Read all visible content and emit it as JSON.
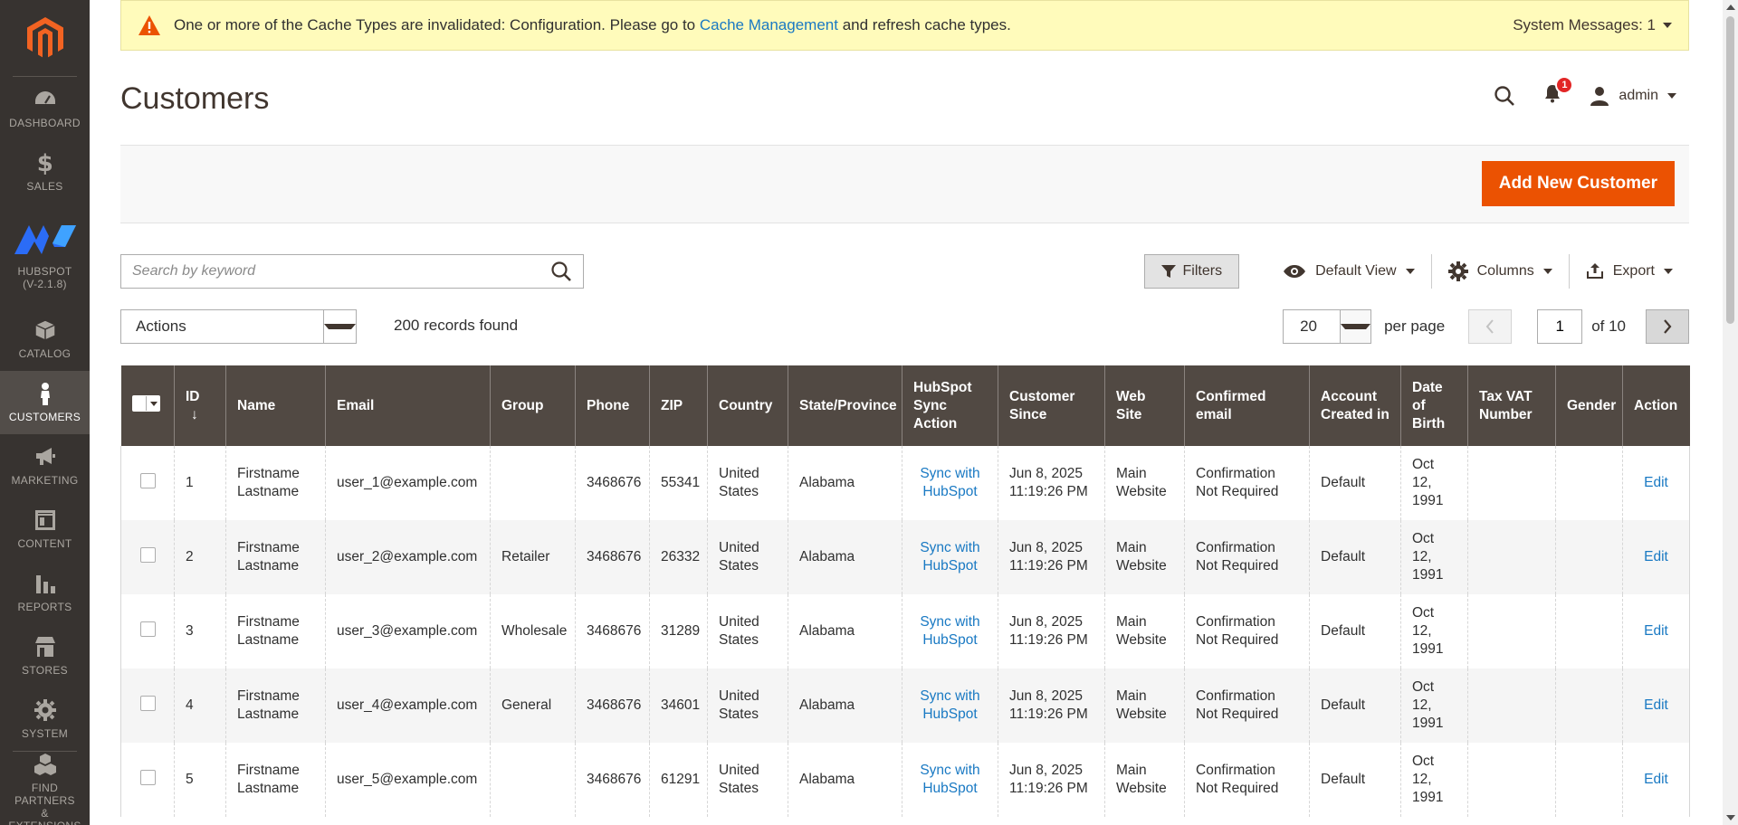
{
  "sidebar": {
    "items": [
      {
        "label": "DASHBOARD",
        "icon": "dashboard-icon"
      },
      {
        "label": "SALES",
        "icon": "dollar-icon"
      },
      {
        "label": "HUBSPOT",
        "sub": "(V-2.1.8)",
        "icon": "hubspot-logo-icon"
      },
      {
        "label": "CATALOG",
        "icon": "box-icon"
      },
      {
        "label": "CUSTOMERS",
        "icon": "person-icon"
      },
      {
        "label": "MARKETING",
        "icon": "megaphone-icon"
      },
      {
        "label": "CONTENT",
        "icon": "layout-icon"
      },
      {
        "label": "REPORTS",
        "icon": "bar-chart-icon"
      },
      {
        "label": "STORES",
        "icon": "store-icon"
      },
      {
        "label": "SYSTEM",
        "icon": "gear-icon"
      },
      {
        "label": "FIND PARTNERS",
        "sub": "& EXTENSIONS",
        "icon": "cubes-icon"
      }
    ]
  },
  "sysmsg": {
    "text_before": "One or more of the Cache Types are invalidated: Configuration. Please go to",
    "link": "Cache Management",
    "text_after": "and refresh cache types.",
    "right": "System Messages: 1"
  },
  "header": {
    "title": "Customers",
    "notifications": "1",
    "user": "admin"
  },
  "toolbar": {
    "add_label": "Add New Customer"
  },
  "search": {
    "placeholder": "Search by keyword"
  },
  "tools": {
    "filters": "Filters",
    "view": "Default View",
    "columns": "Columns",
    "export": "Export"
  },
  "actions": {
    "label": "Actions",
    "records": "200 records found"
  },
  "pager": {
    "per_page_value": "20",
    "per_page_label": "per page",
    "current": "1",
    "of": "of 10"
  },
  "columns": [
    "ID",
    "Name",
    "Email",
    "Group",
    "Phone",
    "ZIP",
    "Country",
    "State/Province",
    "HubSpot Sync Action",
    "Customer Since",
    "Web Site",
    "Confirmed email",
    "Account Created in",
    "Date of Birth",
    "Tax VAT Number",
    "Gender",
    "Action"
  ],
  "sort_indicator": "↓",
  "rows": [
    {
      "id": "1",
      "name": "Firstname Lastname",
      "email": "user_1@example.com",
      "group": "",
      "phone": "3468676",
      "zip": "55341",
      "country": "United States",
      "state": "Alabama",
      "sync": "Sync with HubSpot",
      "since": "Jun 8, 2025 11:19:26 PM",
      "website": "Main Website",
      "confirmed": "Confirmation Not Required",
      "created_in": "Default",
      "dob": "Oct 12, 1991",
      "taxvat": "",
      "gender": "",
      "action": "Edit"
    },
    {
      "id": "2",
      "name": "Firstname Lastname",
      "email": "user_2@example.com",
      "group": "Retailer",
      "phone": "3468676",
      "zip": "26332",
      "country": "United States",
      "state": "Alabama",
      "sync": "Sync with HubSpot",
      "since": "Jun 8, 2025 11:19:26 PM",
      "website": "Main Website",
      "confirmed": "Confirmation Not Required",
      "created_in": "Default",
      "dob": "Oct 12, 1991",
      "taxvat": "",
      "gender": "",
      "action": "Edit"
    },
    {
      "id": "3",
      "name": "Firstname Lastname",
      "email": "user_3@example.com",
      "group": "Wholesale",
      "phone": "3468676",
      "zip": "31289",
      "country": "United States",
      "state": "Alabama",
      "sync": "Sync with HubSpot",
      "since": "Jun 8, 2025 11:19:26 PM",
      "website": "Main Website",
      "confirmed": "Confirmation Not Required",
      "created_in": "Default",
      "dob": "Oct 12, 1991",
      "taxvat": "",
      "gender": "",
      "action": "Edit"
    },
    {
      "id": "4",
      "name": "Firstname Lastname",
      "email": "user_4@example.com",
      "group": "General",
      "phone": "3468676",
      "zip": "34601",
      "country": "United States",
      "state": "Alabama",
      "sync": "Sync with HubSpot",
      "since": "Jun 8, 2025 11:19:26 PM",
      "website": "Main Website",
      "confirmed": "Confirmation Not Required",
      "created_in": "Default",
      "dob": "Oct 12, 1991",
      "taxvat": "",
      "gender": "",
      "action": "Edit"
    },
    {
      "id": "5",
      "name": "Firstname Lastname",
      "email": "user_5@example.com",
      "group": "",
      "phone": "3468676",
      "zip": "61291",
      "country": "United States",
      "state": "Alabama",
      "sync": "Sync with HubSpot",
      "since": "Jun 8, 2025 11:19:26 PM",
      "website": "Main Website",
      "confirmed": "Confirmation Not Required",
      "created_in": "Default",
      "dob": "Oct 12, 1991",
      "taxvat": "",
      "gender": "",
      "action": "Edit"
    }
  ],
  "colors": {
    "sidebar_bg": "#373330",
    "header_bg": "#514943",
    "accent": "#eb5202",
    "link": "#1979c3",
    "sysmsg_bg": "#fffbbb"
  }
}
